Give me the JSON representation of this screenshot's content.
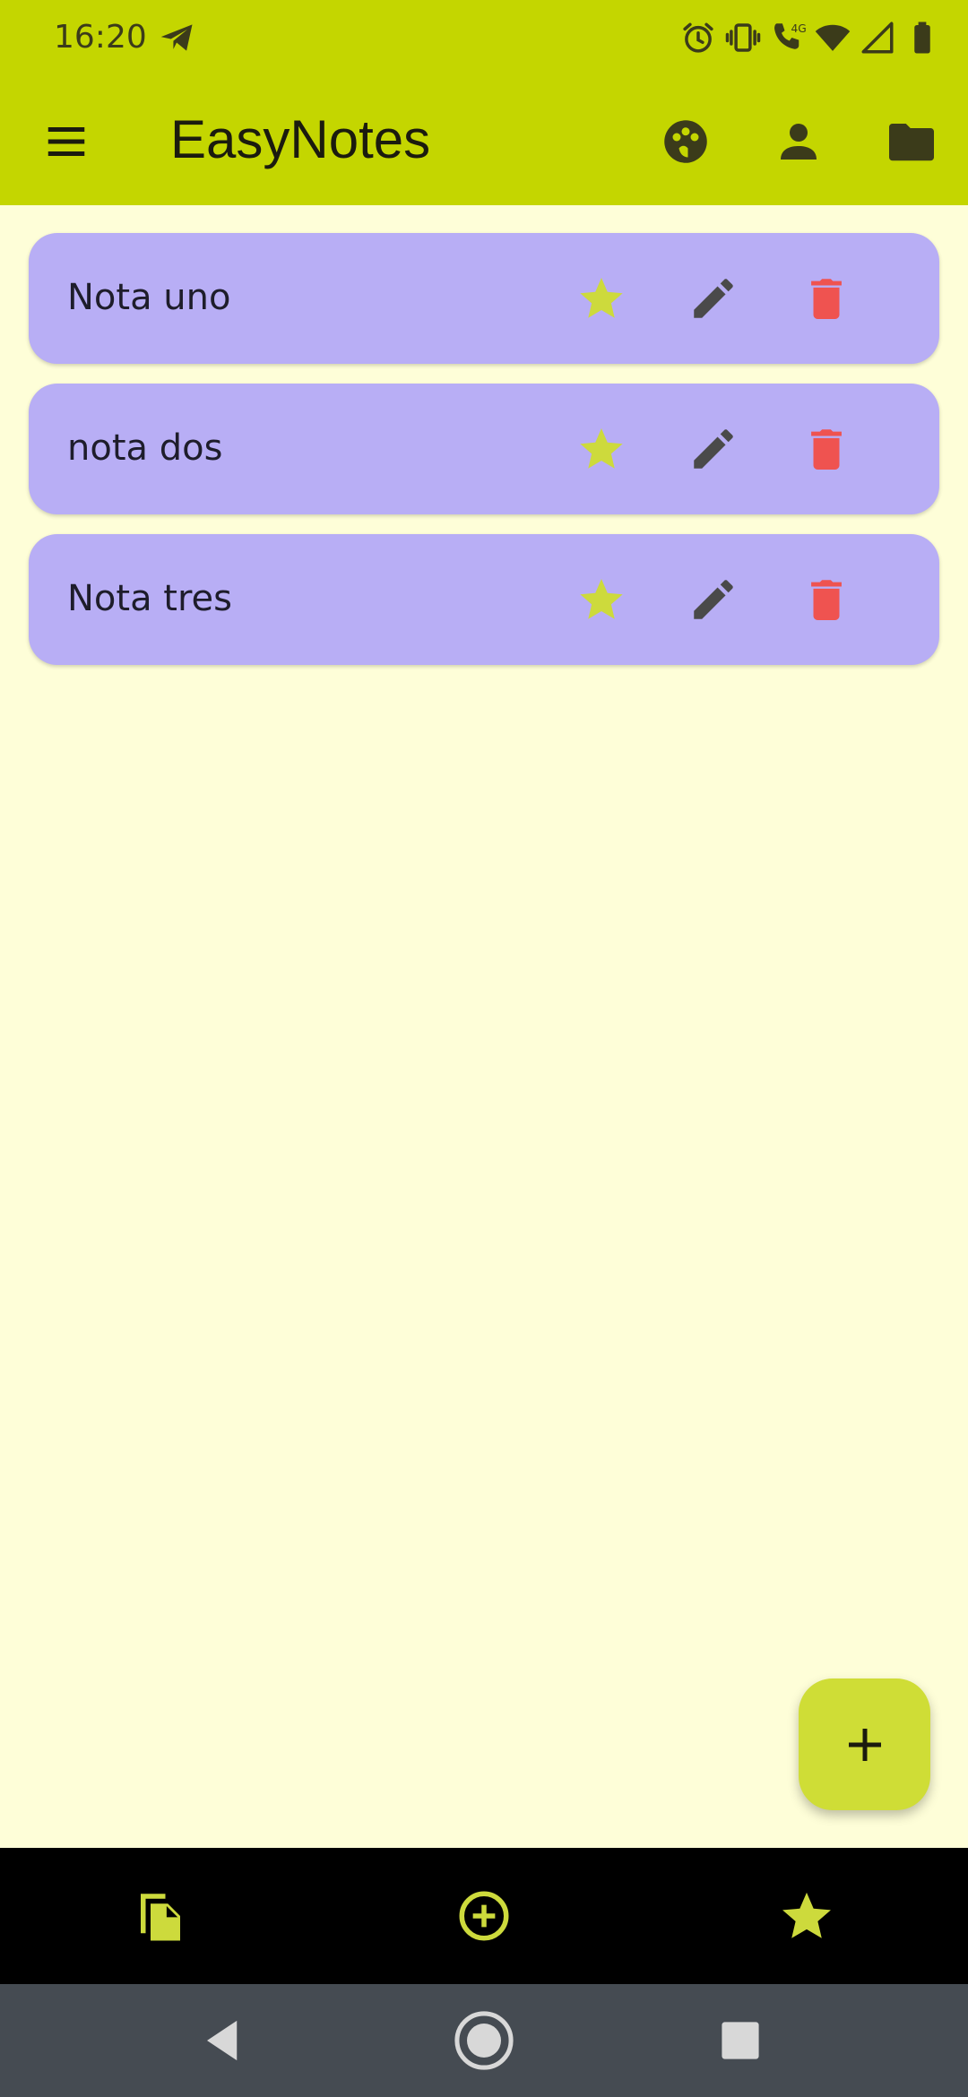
{
  "status_bar": {
    "time": "16:20",
    "icons": [
      "telegram-icon",
      "alarm-icon",
      "vibrate-icon",
      "volte-4g-call-icon",
      "wifi-icon",
      "cell-signal-icon",
      "battery-icon"
    ],
    "network_label": "4G"
  },
  "app_bar": {
    "title": "EasyNotes",
    "leading_icon": "menu-icon",
    "actions": [
      "palette-icon",
      "person-icon",
      "folder-icon"
    ]
  },
  "notes": [
    {
      "title": "Nota uno"
    },
    {
      "title": "nota dos"
    },
    {
      "title": "Nota tres"
    }
  ],
  "note_actions": [
    "star-icon",
    "edit-icon",
    "delete-icon"
  ],
  "fab": {
    "icon": "plus-icon"
  },
  "bottom_nav": {
    "items": [
      "notes-icon",
      "add-circle-icon",
      "star-icon"
    ]
  },
  "system_nav": {
    "items": [
      "back-icon",
      "home-icon",
      "recents-icon"
    ]
  },
  "colors": {
    "app_bar": "#c4d600",
    "background": "#fefed8",
    "note_card": "#b8aef5",
    "star": "#cdda3c",
    "edit": "#4a4a4a",
    "delete": "#ef5350",
    "fab": "#cfdd36",
    "bottom_nav": "#000000",
    "bottom_nav_icon": "#cdda3c",
    "system_nav": "#454b52"
  }
}
